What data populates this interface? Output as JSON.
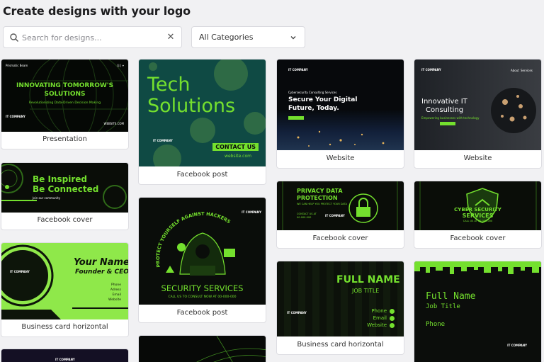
{
  "page": {
    "title": "Create designs with your logo"
  },
  "search": {
    "placeholder": "Search for designs..."
  },
  "filter": {
    "selected": "All Categories"
  },
  "colors": {
    "accent": "#74e02e",
    "dark": "#0b0d0b",
    "panel_bg": "#f1f1f3"
  },
  "logo_text": "IT COMPANY",
  "cards": {
    "presentation": {
      "label": "Presentation",
      "brand": "Prismatic Beam",
      "corner": "Ⓢ | ⌖",
      "headline1": "INNOVATING TOMORROW'S",
      "headline2": "SOLUTIONS",
      "sub": "Revolutionizing Data-Driven Decision Making",
      "site": "WEBSITE.COM"
    },
    "tech": {
      "label": "Facebook post",
      "line1": "Tech",
      "line2": "Solutions",
      "cta": "CONTACT US",
      "site": "website.com"
    },
    "web1": {
      "label": "Website",
      "kicker": "Cybersecurity Consulting Services",
      "h1": "Secure Your Digital",
      "h2": "Future, Today."
    },
    "web2": {
      "label": "Website",
      "h1": "Innovative IT",
      "h2": "Consulting",
      "sub": "Empowering businesses with technology",
      "nav1": "About",
      "nav2": "Services"
    },
    "fbc1": {
      "label": "Facebook cover",
      "line1": "Be Inspired",
      "line2": "Be Connected",
      "sub": "Join our community"
    },
    "security": {
      "label": "Facebook post",
      "arc": "PROTECT YOURSELF AGAINST HACKERS",
      "title": "SECURITY SERVICES",
      "sub": "CALL US TO CONSULT NOW AT 00-000-000"
    },
    "privacy": {
      "label": "Facebook cover",
      "h1": "PRIVACY DATA",
      "h2": "PROTECTION",
      "sub": "WE CAN HELP YOU PROTECT YOUR DATA",
      "contact1": "CONTACT US AT",
      "contact2": "00-000-000"
    },
    "cyber": {
      "label": "Facebook cover",
      "h1": "CYBER SECURITY",
      "h2": "SERVICES",
      "sub": "CALL US AT 00-000-000"
    },
    "bizcard1": {
      "label": "Business card horizontal",
      "name": "Your Name",
      "role": "Founder & CEO",
      "f1": "Phone",
      "f2": "Adress",
      "f3": "Email",
      "f4": "Website"
    },
    "bizcard2": {
      "label": "Business card horizontal",
      "name": "FULL NAME",
      "role": "JOB TITLE",
      "f1": "Phone",
      "f2": "Email",
      "f3": "Website"
    },
    "pixel": {
      "name": "Full Name",
      "role": "Job Title",
      "f1": "Phone"
    }
  }
}
